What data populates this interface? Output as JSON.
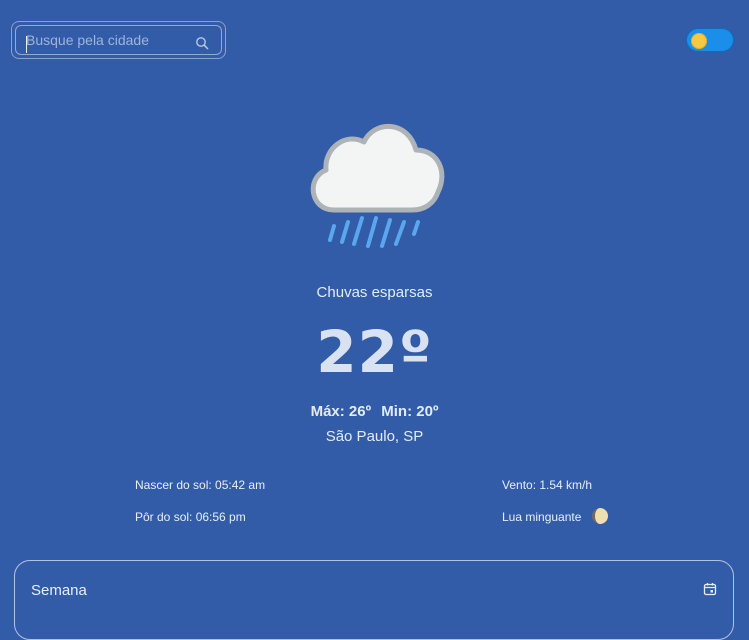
{
  "search": {
    "placeholder": "Busque pela cidade",
    "icon": "search-icon"
  },
  "theme_toggle": {
    "state": "light",
    "icon": "sun-icon",
    "accent": "#1a8ee8"
  },
  "current": {
    "icon": "rain-cloud-icon",
    "condition": "Chuvas esparsas",
    "temperature": "22º",
    "max": "Máx: 26º",
    "min": "Min: 20º",
    "city": "São Paulo, SP"
  },
  "details": {
    "sunrise": "Nascer do sol: 05:42 am",
    "sunset": "Pôr do sol: 06:56 pm",
    "wind": "Vento: 1.54 km/h",
    "moon": "Lua minguante",
    "moon_icon": "moon-icon"
  },
  "week": {
    "title": "Semana",
    "icon": "calendar-icon"
  },
  "colors": {
    "background": "#325ca7",
    "text": "#e8eef8",
    "rain": "#5aa7ee"
  }
}
